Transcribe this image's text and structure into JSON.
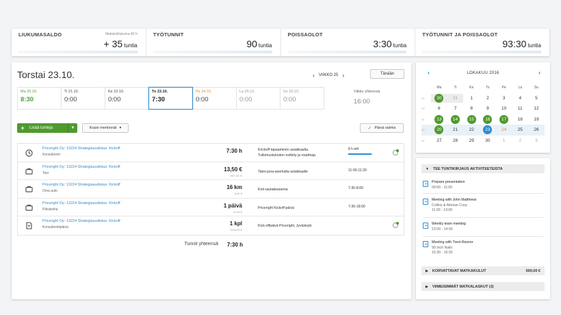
{
  "summary": [
    {
      "title": "LIUKUMASALDO",
      "sub": "Maksimiliukuma  40 h",
      "value": "+ 35",
      "unit": "tuntia"
    },
    {
      "title": "TYÖTUNNIT",
      "sub": "",
      "value": "90",
      "unit": "tuntia"
    },
    {
      "title": "POISSAOLOT",
      "sub": "",
      "value": "3:30",
      "unit": "tuntia"
    },
    {
      "title": "TYÖTUNNIT JA POISSAOLOT",
      "sub": "",
      "value": "93:30",
      "unit": "tuntia"
    }
  ],
  "header": {
    "day_title": "Torstai 23.10.",
    "week": "VIIKKO 25",
    "today": "Tänään"
  },
  "days": [
    {
      "name": "Ma 20.10.",
      "value": "8:30"
    },
    {
      "name": "Ti 21.10.",
      "value": "0:00"
    },
    {
      "name": "Ke 22.10.",
      "value": "0:00"
    },
    {
      "name": "To 23.10.",
      "value": "7:30"
    },
    {
      "name": "Pe 24.10.",
      "value": "0:00"
    },
    {
      "name": "La 25.10.",
      "value": "0:00"
    },
    {
      "name": "Su 26.10.",
      "value": "0:00"
    }
  ],
  "week_total": {
    "label": "Viikko yhteensä",
    "value": "16:00"
  },
  "actions": {
    "add": "Lisää tunteja",
    "copy": "Kopio merkinnät",
    "ready": "Päivä valmis"
  },
  "entries": [
    {
      "project": "Priceright Oy: 13224 Strategiauudistus: Kickoff",
      "type": "Konsultointi",
      "amount": "7:30 h",
      "sub": "",
      "desc1": "Kirckoff tapaaminen asiakkaalla.",
      "desc2": "Tutkimustulosten esittely ja roadmap.",
      "time": "",
      "left": "8 h left",
      "progress": 0.94,
      "icon": "clock-icon",
      "comment": true
    },
    {
      "project": "Priceright Oy: 13224 Strategiauudistus: Kickoff",
      "type": "Taxi",
      "amount": "13,50 €",
      "sub": "VAT 24 %",
      "desc1": "Taksi juna-asemalta asiakkaalle",
      "desc2": "",
      "time": "11:00-11:20",
      "left": "",
      "icon": "briefcase-icon",
      "comment": false
    },
    {
      "project": "Priceright Oy: 13224 Strategiauudistus: Kickoff",
      "type": "Oma auto",
      "amount": "16 km",
      "sub": "5,60 €",
      "desc1": "Koti-rautatieasema",
      "desc2": "",
      "time": "7:30-8:00",
      "left": "",
      "icon": "briefcase-icon",
      "comment": false
    },
    {
      "project": "Priceright Oy: 13224 Strategiauudistus: Kickoff",
      "type": "Päiväraha",
      "amount": "1 päivä",
      "sub": "41,00 €",
      "desc1": "Priceright Kickoff-päivä",
      "desc2": "",
      "time": "7:30-18:00",
      "left": "",
      "icon": "briefcase-icon",
      "comment": false
    },
    {
      "project": "Priceright Oy: 13224 Strategiauudistus: Kickoff",
      "type": "Konsultointipäivä",
      "amount": "1 kpl",
      "sub": "1500,00 €",
      "desc1": "Kick-offpäivä Priceright, Jyväskylä",
      "desc2": "",
      "time": "",
      "left": "",
      "icon": "document-icon",
      "comment": true
    }
  ],
  "total": {
    "label": "Tunnit yhteensä",
    "value": "7:30 h"
  },
  "calendar": {
    "month": "LOKAKUU   2016",
    "weekdays": [
      "Ma",
      "Ti",
      "Ke",
      "To",
      "Pe",
      "La",
      "Su"
    ],
    "weeks": [
      {
        "wk": "22",
        "days": [
          "30",
          "31",
          "1",
          "2",
          "3",
          "4",
          "5"
        ]
      },
      {
        "wk": "23",
        "days": [
          "6",
          "7",
          "8",
          "9",
          "10",
          "11",
          "12"
        ]
      },
      {
        "wk": "24",
        "days": [
          "13",
          "14",
          "15",
          "16",
          "17",
          "18",
          "19"
        ]
      },
      {
        "wk": "25",
        "days": [
          "20",
          "21",
          "22",
          "23",
          "24",
          "25",
          "26"
        ]
      },
      {
        "wk": "26",
        "days": [
          "27",
          "28",
          "29",
          "30",
          "1",
          "2",
          "3"
        ]
      }
    ]
  },
  "side": {
    "activities_title": "TEE TUNTIKIRJAUS AKTIVITEETEISTA",
    "activities": [
      {
        "title": "Prepare presentation",
        "lines": [
          "09:00 - 11:00"
        ]
      },
      {
        "title": "Meeting with John Matthews",
        "lines": [
          "Collins & Aikman Corp.",
          "11:00 - 13:00"
        ]
      },
      {
        "title": "Weekly team meeting",
        "lines": [
          "13:00 - 14:00"
        ]
      },
      {
        "title": "Meeting with Trent Reznor",
        "lines": [
          "99 Inch Nails",
          "15:30 - 16:30"
        ]
      }
    ],
    "travel_title": "KORVATTAVAT MATKAKULUT",
    "travel_amount": "500,00 €",
    "recent_title": "VIIMEISIMMÄT MATKALASKUT (3)"
  },
  "colors": {
    "accent": "#2e8bd0",
    "green": "#4f9a2e",
    "orange": "#e08a2a"
  }
}
